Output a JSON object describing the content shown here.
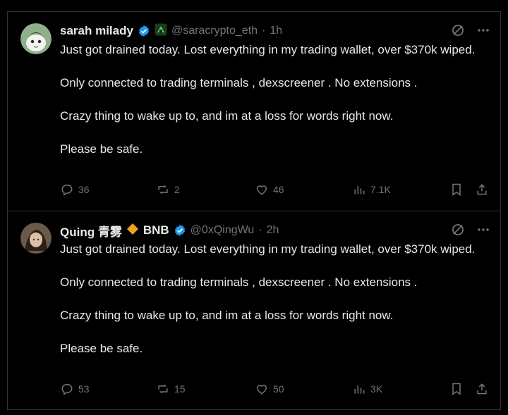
{
  "tweets": [
    {
      "name": "sarah milady",
      "handle": "@saracrypto_eth",
      "separator": "·",
      "time": "1h",
      "paragraphs": [
        "Just got drained today. Lost everything in my trading wallet, over $370k wiped.",
        "Only connected to trading terminals , dexscreener . No extensions .",
        "Crazy thing to wake up to, and im at a loss for words right now.",
        "Please be safe."
      ],
      "replies": "36",
      "reposts": "2",
      "likes": "46",
      "views": "7.1K"
    },
    {
      "name": "Quing 青雾",
      "name_suffix": "BNB",
      "handle": "@0xQingWu",
      "separator": "·",
      "time": "2h",
      "paragraphs": [
        "Just got drained today. Lost everything in my trading wallet, over $370k wiped.",
        "Only connected to trading terminals , dexscreener . No extensions .",
        "Crazy thing to wake up to, and im at a loss for words right now.",
        "Please be safe."
      ],
      "replies": "53",
      "reposts": "15",
      "likes": "50",
      "views": "3K"
    }
  ],
  "colors": {
    "background": "#000000",
    "text": "#e7e9ea",
    "muted": "#71767b",
    "verified": "#1d9bf0",
    "bnb": "#f0a020",
    "border": "#2f3336"
  }
}
